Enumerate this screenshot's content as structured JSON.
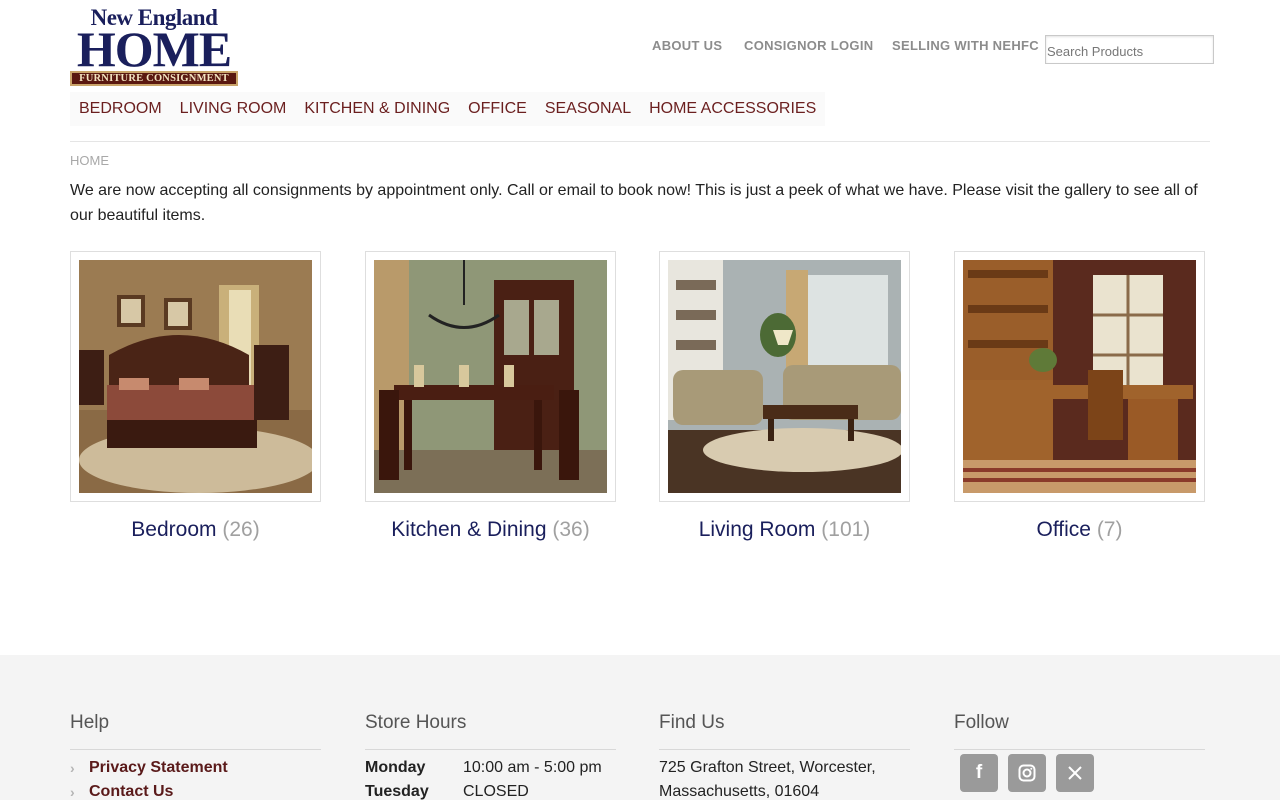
{
  "logo": {
    "line1": "New England",
    "line2": "HOME",
    "line3": "FURNITURE CONSIGNMENT"
  },
  "topnav": [
    "ABOUT US",
    "CONSIGNOR LOGIN",
    "SELLING WITH NEHFC"
  ],
  "search": {
    "placeholder": "Search Products"
  },
  "mainnav": [
    "BEDROOM",
    "LIVING ROOM",
    "KITCHEN & DINING",
    "OFFICE",
    "SEASONAL",
    "HOME ACCESSORIES"
  ],
  "breadcrumb": "HOME",
  "intro": "We are now accepting all consignments by appointment only. Call or email to book now! This is just a peek of what we have. Please visit the gallery to see all of our beautiful items.",
  "categories": [
    {
      "name": "Bedroom",
      "count": "(26)"
    },
    {
      "name": "Kitchen & Dining",
      "count": "(36)"
    },
    {
      "name": "Living Room",
      "count": "(101)"
    },
    {
      "name": "Office",
      "count": "(7)"
    }
  ],
  "footer": {
    "help": {
      "title": "Help",
      "links": [
        "Privacy Statement",
        "Contact Us"
      ]
    },
    "hours": {
      "title": "Store Hours",
      "rows": [
        {
          "day": "Monday",
          "time": "10:00 am - 5:00 pm"
        },
        {
          "day": "Tuesday",
          "time": "CLOSED"
        }
      ]
    },
    "find": {
      "title": "Find Us",
      "line1": "725 Grafton Street, Worcester,",
      "line2": "Massachusetts, 01604"
    },
    "follow": {
      "title": "Follow",
      "icons": [
        "facebook-icon",
        "instagram-icon",
        "x-icon"
      ]
    }
  },
  "colors": {
    "brand_navy": "#1a1f5c",
    "nav_maroon": "#6b1f1f",
    "footer_bg": "#f4f4f4"
  }
}
